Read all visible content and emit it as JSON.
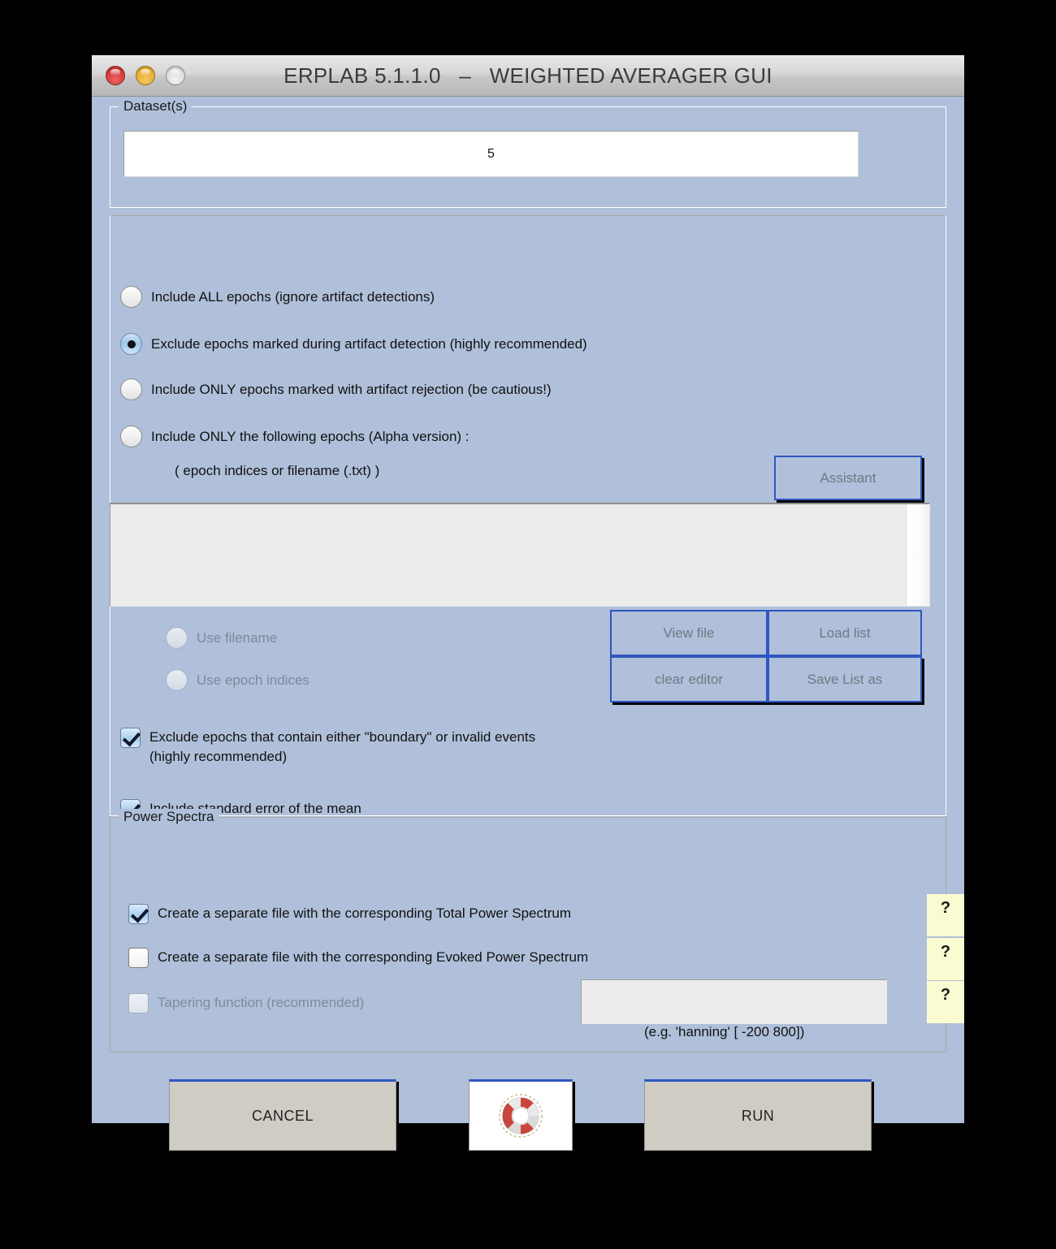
{
  "window": {
    "title": "ERPLAB 5.1.1.0   –   WEIGHTED AVERAGER GUI",
    "traffic": {
      "close": "close-button",
      "minimize": "minimize-button",
      "zoom": "zoom-button"
    }
  },
  "dataset_group": {
    "title": "Dataset(s)",
    "field_value": "5"
  },
  "epochs_panel": {
    "radios": [
      {
        "label": "Include ALL epochs (ignore artifact detections)",
        "selected": false,
        "enabled": true
      },
      {
        "label": "Exclude epochs marked during artifact detection (highly recommended)",
        "selected": true,
        "enabled": true
      },
      {
        "label": "Include ONLY epochs marked with artifact rejection (be cautious!)",
        "selected": false,
        "enabled": true
      },
      {
        "label": "Include ONLY the following epochs (Alpha version)  :",
        "selected": false,
        "enabled": true
      }
    ],
    "hint": "( epoch indices or filename (.txt) )",
    "assistant_button": "Assistant",
    "editor_value": "",
    "source_radios": [
      {
        "label": "Use filename",
        "selected": false,
        "enabled": false
      },
      {
        "label": "Use epoch indices",
        "selected": false,
        "enabled": false
      }
    ],
    "file_buttons": {
      "view_file": "View file",
      "load_list": "Load list",
      "clear_editor": "clear editor",
      "save_list_as": "Save List as"
    },
    "checkboxes": [
      {
        "label": "Exclude epochs that contain either \"boundary\" or invalid events\n (highly recommended)",
        "checked": true,
        "enabled": true
      },
      {
        "label": "Include standard error of the mean",
        "checked": true,
        "enabled": true
      }
    ]
  },
  "power_spectra": {
    "title": "Power Spectra",
    "options": [
      {
        "label": "Create a separate file with the corresponding Total Power Spectrum",
        "checked": true,
        "enabled": true,
        "help": "?"
      },
      {
        "label": "Create a separate file with the corresponding Evoked Power Spectrum",
        "checked": false,
        "enabled": true,
        "help": "?"
      },
      {
        "label": "Tapering function (recommended)",
        "checked": false,
        "enabled": false,
        "help": "?"
      }
    ],
    "taper_field_value": "",
    "taper_hint": "(e.g.  'hanning'  [ -200  800])"
  },
  "footer": {
    "cancel": "CANCEL",
    "help_icon": "lifebuoy-icon",
    "run": "RUN"
  },
  "colors": {
    "window_background": "#b0c0da",
    "titlebar_top": "#e9e9e9",
    "button_border_accent": "#2f56c0",
    "help_button_background": "#fbfbd2",
    "main_button_background": "#cfccc4",
    "desktop": "#000000"
  }
}
